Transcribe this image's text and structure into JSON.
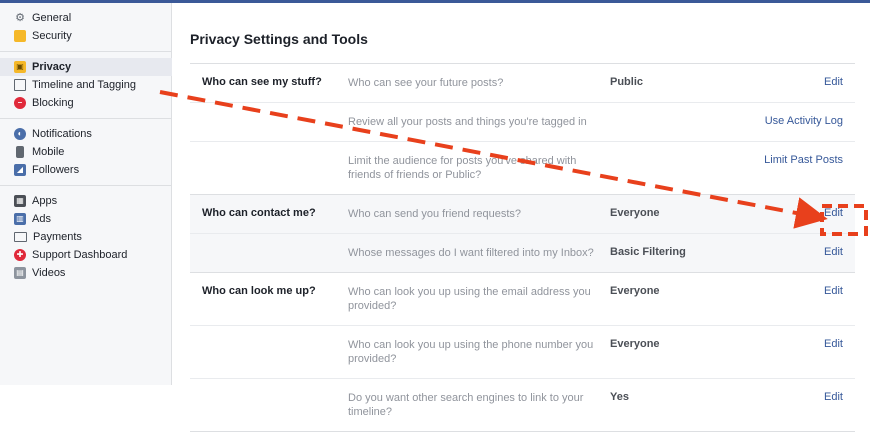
{
  "sidebar": {
    "groups": [
      [
        {
          "label": "General",
          "icon": "gears-icon"
        },
        {
          "label": "Security",
          "icon": "shield-icon"
        }
      ],
      [
        {
          "label": "Privacy",
          "icon": "lock-icon"
        },
        {
          "label": "Timeline and Tagging",
          "icon": "timeline-icon"
        },
        {
          "label": "Blocking",
          "icon": "block-icon"
        }
      ],
      [
        {
          "label": "Notifications",
          "icon": "globe-icon"
        },
        {
          "label": "Mobile",
          "icon": "phone-icon"
        },
        {
          "label": "Followers",
          "icon": "rss-icon"
        }
      ],
      [
        {
          "label": "Apps",
          "icon": "apps-icon"
        },
        {
          "label": "Ads",
          "icon": "ads-icon"
        },
        {
          "label": "Payments",
          "icon": "card-icon"
        },
        {
          "label": "Support Dashboard",
          "icon": "lifebuoy-icon"
        },
        {
          "label": "Videos",
          "icon": "film-icon"
        }
      ]
    ],
    "active": "Privacy"
  },
  "page": {
    "title": "Privacy Settings and Tools"
  },
  "sections": [
    {
      "category": "Who can see my stuff?",
      "rows": [
        {
          "question": "Who can see your future posts?",
          "value": "Public",
          "action": "Edit"
        },
        {
          "question": "Review all your posts and things you're tagged in",
          "value": "",
          "action": "Use Activity Log"
        },
        {
          "question": "Limit the audience for posts you've shared with friends of friends or Public?",
          "value": "",
          "action": "Limit Past Posts"
        }
      ]
    },
    {
      "category": "Who can contact me?",
      "rows": [
        {
          "question": "Who can send you friend requests?",
          "value": "Everyone",
          "action": "Edit"
        },
        {
          "question": "Whose messages do I want filtered into my Inbox?",
          "value": "Basic Filtering",
          "action": "Edit"
        }
      ]
    },
    {
      "category": "Who can look me up?",
      "rows": [
        {
          "question": "Who can look you up using the email address you provided?",
          "value": "Everyone",
          "action": "Edit"
        },
        {
          "question": "Who can look you up using the phone number you provided?",
          "value": "Everyone",
          "action": "Edit"
        },
        {
          "question": "Do you want other search engines to link to your timeline?",
          "value": "Yes",
          "action": "Edit"
        }
      ]
    }
  ],
  "colors": {
    "link": "#365899",
    "brand": "#3b5998",
    "annotation": "#e8401c"
  }
}
